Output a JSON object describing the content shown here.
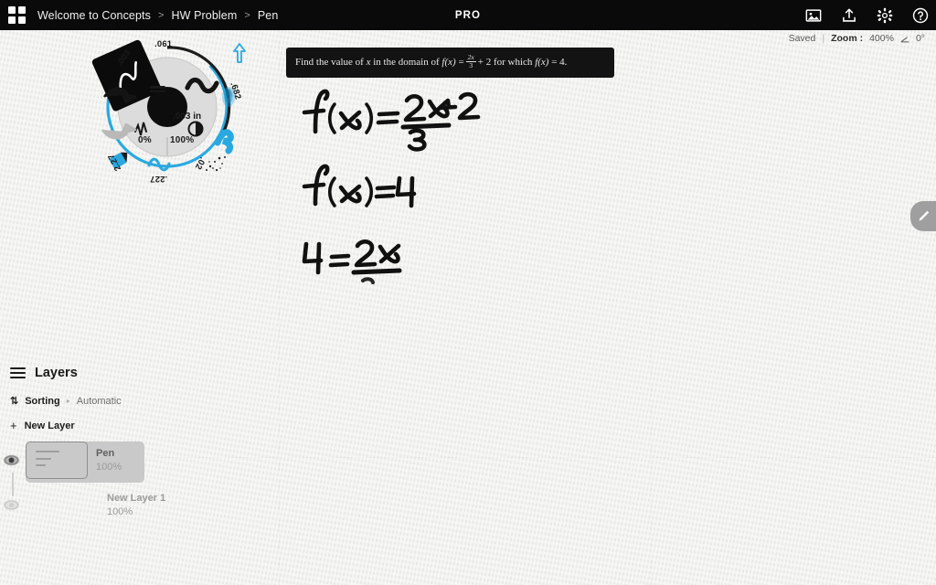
{
  "app": {
    "name": "Concepts",
    "menu_icon": "grid-icon",
    "pro_badge": "PRO"
  },
  "topbar": {
    "breadcrumb": [
      {
        "label": "Welcome to Concepts",
        "icon": null
      },
      {
        "label": "HW Problem",
        "icon": null
      },
      {
        "label": "Pen",
        "icon": null
      }
    ],
    "separator": ">",
    "icons": [
      {
        "name": "image-gallery-icon",
        "title": "Gallery"
      },
      {
        "name": "upload-export-icon",
        "title": "Export"
      },
      {
        "name": "gear-settings-icon",
        "title": "Settings"
      },
      {
        "name": "help-question-icon",
        "title": "Help"
      }
    ]
  },
  "status": {
    "saved": "Saved",
    "divider": "|",
    "zoom_label": "Zoom :",
    "zoom_value": "400%",
    "angle_icon": "angle-icon",
    "angle_value": "0°"
  },
  "problem": {
    "prefix": "Find the value of ",
    "var1": "x",
    "mid1": " in the domain of ",
    "fn1": "f",
    "fn1_arg": "(x)",
    "eq1": "=",
    "frac_num": "2x",
    "frac_den": "3",
    "plus": "+ 2",
    "mid2": " for which ",
    "fn2": "f",
    "fn2_arg": "(x)",
    "eq2": "= 4."
  },
  "handwriting": {
    "line1": "f(x) = 2x/3 + 2",
    "line2": "f(x) = 4",
    "line3": "4 = 2x/"
  },
  "dial": {
    "center_size": ".003 in",
    "center_icon": "stroke-weight-icon",
    "smoothing_icon": "smoothing-icon",
    "opacity_icon": "opacity-half-circle-icon",
    "min_percent": "0%",
    "max_percent": "100%",
    "selected_tool": {
      "label": ".003",
      "name": "pen-tool-card",
      "glyph": "pen-stroke-glyph"
    },
    "tools": [
      {
        "label": ".061",
        "name": "brush-tool",
        "glyph": "thick-wave-glyph"
      },
      {
        "label": ".682",
        "name": "airbrush-tool",
        "glyph": "soft-blur-glyph"
      },
      {
        "label": ".02",
        "name": "spray-tool",
        "glyph": "spray-dots-glyph"
      },
      {
        "label": ".227",
        "name": "marker-tool",
        "glyph": "wavy-line-glyph"
      },
      {
        "label": "2.27",
        "name": "chisel-tool",
        "glyph": "chisel-glyph"
      }
    ],
    "undo_icon": "undo-arrow-icon",
    "redo_icon": "redo-arrow-icon",
    "precision_icon": "precision-pointer-icon"
  },
  "layers": {
    "title": "Layers",
    "menu_icon": "layers-lines-icon",
    "sorting_icon": "sort-updown-icon",
    "sorting_label": "Sorting",
    "sorting_arrow": "▸",
    "sorting_value": "Automatic",
    "new_layer_icon": "plus-icon",
    "new_layer_label": "New Layer",
    "items": [
      {
        "name": "Pen",
        "opacity": "100%",
        "selected": true,
        "visible": true,
        "eye_icon": "eye-visible-icon"
      },
      {
        "name": "New Layer 1",
        "opacity": "100%",
        "selected": false,
        "visible": false,
        "eye_icon": "eye-hidden-icon"
      }
    ]
  },
  "right_tab": {
    "name": "pen-tool-tab",
    "icon": "pen-icon"
  },
  "colors": {
    "topbar_bg": "#0a0a0a",
    "canvas_bg": "#eeeeec",
    "accent_blue": "#2aa9e0",
    "banner_bg": "#131313",
    "ink": "#111111",
    "layer_selected_bg": "#c9c9c9"
  }
}
